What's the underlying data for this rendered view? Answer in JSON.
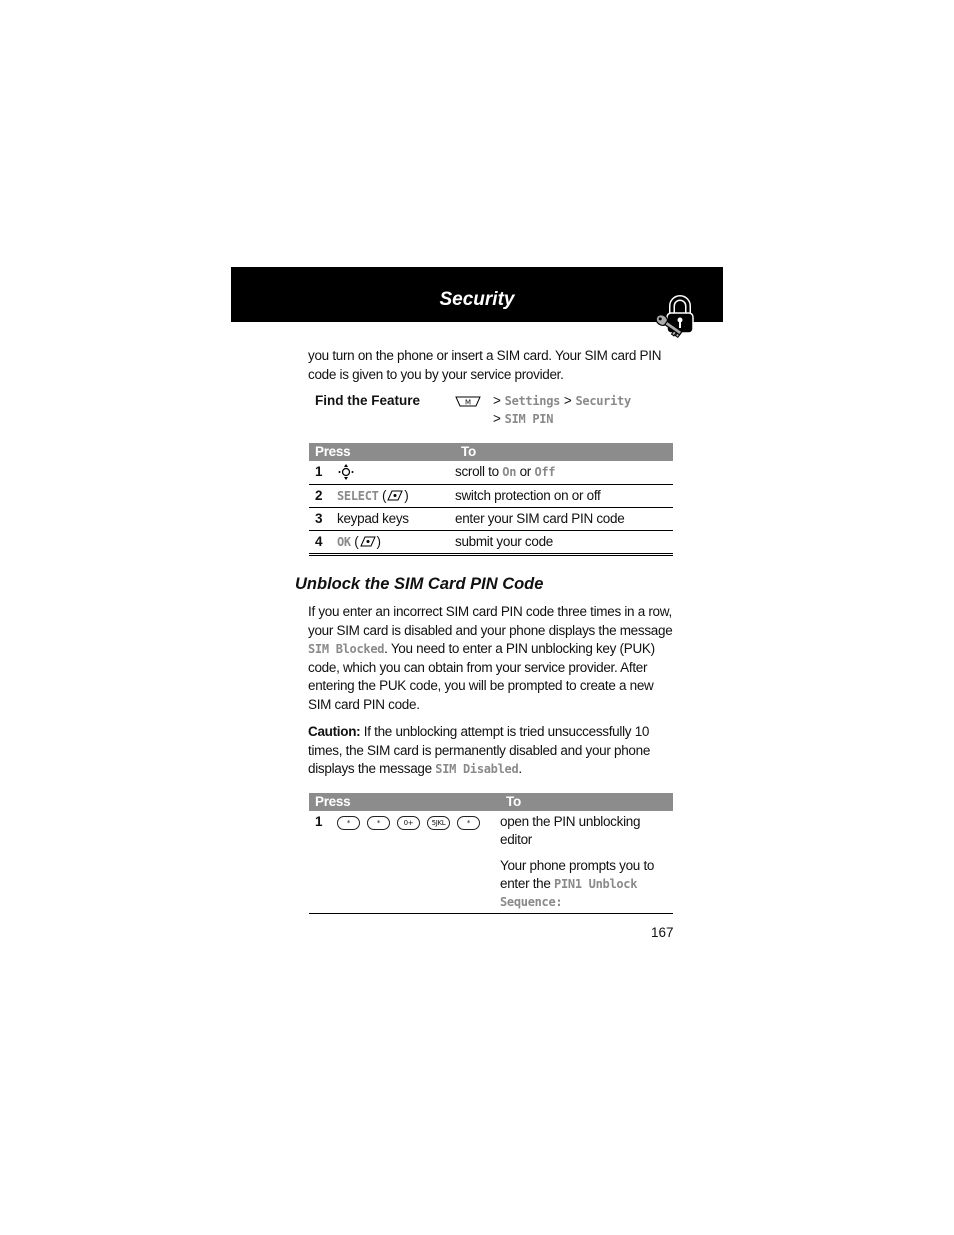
{
  "header": {
    "title": "Security",
    "icon": "lock-and-key-icon"
  },
  "intro_text": "you turn on the phone or insert a SIM card. Your SIM card PIN code is given to you by your service provider.",
  "find_feature": {
    "label": "Find the Feature",
    "menu_key": "M",
    "path_sep": ">",
    "path": [
      "Settings",
      "Security",
      "SIM PIN"
    ]
  },
  "table1": {
    "headers": {
      "press": "Press",
      "to": "To"
    },
    "rows": [
      {
        "num": "1",
        "press_icon": "nav-key-icon",
        "press": "",
        "to_pre": "scroll to ",
        "to_mono1": "On",
        "to_mid": " or ",
        "to_mono2": "Off"
      },
      {
        "num": "2",
        "press_mono": "SELECT",
        "press_key": "softkey-icon",
        "to": "switch protection on or off"
      },
      {
        "num": "3",
        "press": "keypad keys",
        "to": "enter your SIM card PIN code"
      },
      {
        "num": "4",
        "press_mono": "OK",
        "press_key": "softkey-icon",
        "to": "submit your code"
      }
    ]
  },
  "section": {
    "heading": "Unblock the SIM Card PIN Code",
    "para1_a": "If you enter an incorrect SIM card PIN code three times in a row, your SIM card is disabled and your phone displays the message ",
    "para1_mono": "SIM Blocked",
    "para1_b": ". You need to enter a PIN unblocking key (PUK) code, which you can obtain from your service provider. After entering the PUK code, you will be prompted to create a new SIM card PIN code.",
    "caution_label": "Caution:",
    "caution_a": " If the unblocking attempt is tried unsuccessfully 10 times, the SIM card is permanently disabled and your phone displays the message ",
    "caution_mono": "SIM Disabled",
    "caution_b": "."
  },
  "table2": {
    "headers": {
      "press": "Press",
      "to": "To"
    },
    "rows": [
      {
        "num": "1",
        "keys": [
          "*",
          "*",
          "0+",
          "5JKL",
          "*"
        ],
        "to": "open the PIN unblocking editor"
      }
    ],
    "note_a": "Your phone prompts you to enter the ",
    "note_mono": "PIN1 Unblock Sequence:"
  },
  "page_number": "167"
}
